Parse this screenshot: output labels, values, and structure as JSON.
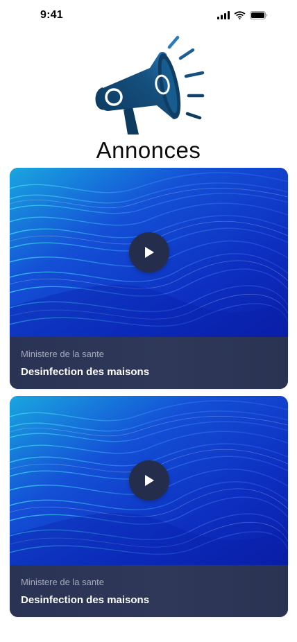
{
  "status_bar": {
    "time": "9:41",
    "icons": [
      "signal-icon",
      "wifi-icon",
      "battery-icon"
    ]
  },
  "hero": {
    "icon": "megaphone-icon",
    "title": "Annonces"
  },
  "colors": {
    "megaphone_dark": "#10426b",
    "megaphone_light": "#2c7cbd",
    "card_footer": "#2a3353",
    "play_button": "#252d4d",
    "wave_dark": "#0b23b8",
    "wave_light": "#27c6e3"
  },
  "announcements": [
    {
      "source": "Ministere de la sante",
      "title": "Desinfection des maisons",
      "play_icon": "play-icon"
    },
    {
      "source": "Ministere de la sante",
      "title": "Desinfection des maisons",
      "play_icon": "play-icon"
    }
  ]
}
